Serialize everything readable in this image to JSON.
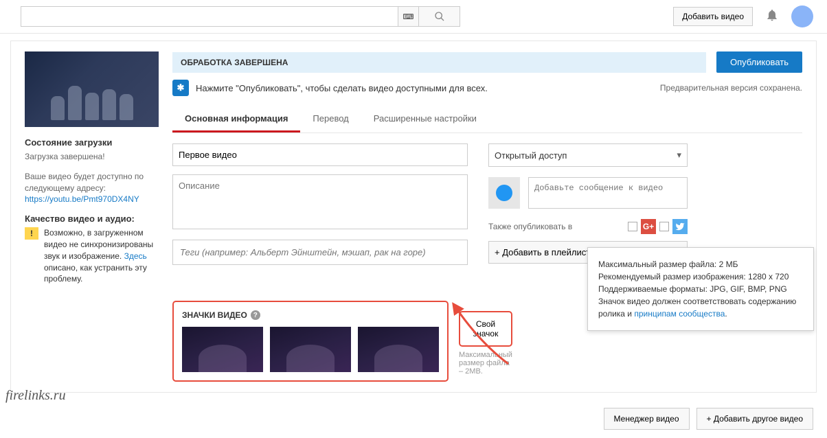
{
  "header": {
    "search_placeholder": "",
    "add_video": "Добавить видео"
  },
  "sidebar": {
    "upload_status_heading": "Состояние загрузки",
    "upload_complete": "Загрузка завершена!",
    "video_available_text": "Ваше видео будет доступно по следующему адресу:",
    "video_url": "https://youtu.be/Pmt970DX4NY",
    "quality_heading": "Качество видео и аудио:",
    "warning_text_1": "Возможно, в загруженном видео не синхронизированы звук и изображение. ",
    "warning_link": "Здесь",
    "warning_text_2": " описано, как устранить эту проблему."
  },
  "content": {
    "processing_complete": "ОБРАБОТКА ЗАВЕРШЕНА",
    "publish_btn": "Опубликовать",
    "notice_text": "Нажмите \"Опубликовать\", чтобы сделать видео доступными для всех.",
    "saved_text": "Предварительная версия сохранена.",
    "tabs": {
      "basic": "Основная информация",
      "translation": "Перевод",
      "advanced": "Расширенные настройки"
    },
    "title_value": "Первое видео",
    "description_placeholder": "Описание",
    "tags_placeholder": "Теги (например: Альберт Эйнштейн, мэшап, рак на горе)",
    "visibility": "Открытый доступ",
    "share_placeholder": "Добавьте сообщение к видео",
    "also_publish": "Также опубликовать в",
    "add_playlist": "+ Добавить в плейлист",
    "thumbnails_heading": "ЗНАЧКИ ВИДЕО",
    "custom_thumb_btn": "Свой значок",
    "max_size": "Максимальный размер файла – 2MB."
  },
  "tooltip": {
    "line1": "Максимальный размер файла: 2 МБ",
    "line2": "Рекомендуемый размер изображения: 1280 x 720",
    "line3": "Поддерживаемые форматы: JPG, GIF, BMP, PNG",
    "line4_a": "Значок видео должен соответствовать содержанию ролика и ",
    "line4_link": "принципам сообщества",
    "line4_b": "."
  },
  "bottom": {
    "manager": "Менеджер видео",
    "add_another": "+ Добавить другое видео"
  },
  "watermark": "firelinks.ru"
}
